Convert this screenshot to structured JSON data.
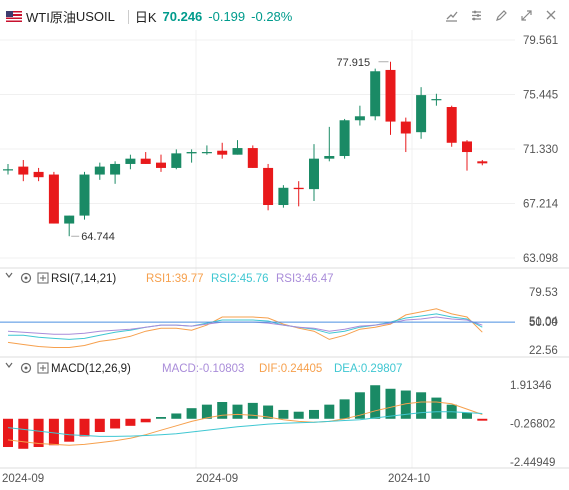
{
  "header": {
    "instrument": "WTI原油",
    "symbol": "USOIL",
    "period": "日K",
    "last": "70.246",
    "change": "-0.199",
    "change_pct": "-0.28%"
  },
  "colors": {
    "up": "#1a8a65",
    "down": "#e8191b",
    "rsi1": "#f6a04d",
    "rsi2": "#3fc7d2",
    "rsi3": "#a98cd9",
    "macd": "#a98cd9",
    "dif": "#f6a04d",
    "dea": "#3fc7d2",
    "accent": "#009b8c"
  },
  "chart_data": [
    {
      "type": "candlestick",
      "y_ticks": [
        "79.561",
        "75.445",
        "71.330",
        "67.214",
        "63.098"
      ],
      "ylim": [
        63.098,
        79.561
      ],
      "x_labels": [
        "2024-09",
        "2024-09",
        "2024-10"
      ],
      "annotations": {
        "high": "77.915",
        "low": "64.744"
      },
      "candles": [
        {
          "o": 69.8,
          "h": 70.2,
          "l": 69.4,
          "c": 69.8
        },
        {
          "o": 70.0,
          "h": 70.5,
          "l": 68.9,
          "c": 69.4
        },
        {
          "o": 69.6,
          "h": 69.9,
          "l": 68.9,
          "c": 69.2
        },
        {
          "o": 69.4,
          "h": 69.6,
          "l": 65.7,
          "c": 65.7
        },
        {
          "o": 65.7,
          "h": 66.3,
          "l": 64.744,
          "c": 66.3
        },
        {
          "o": 66.3,
          "h": 69.6,
          "l": 66.0,
          "c": 69.4
        },
        {
          "o": 69.4,
          "h": 70.3,
          "l": 69.0,
          "c": 70.0
        },
        {
          "o": 69.4,
          "h": 70.4,
          "l": 68.7,
          "c": 70.2
        },
        {
          "o": 70.2,
          "h": 70.9,
          "l": 69.8,
          "c": 70.6
        },
        {
          "o": 70.6,
          "h": 71.1,
          "l": 70.2,
          "c": 70.2
        },
        {
          "o": 70.3,
          "h": 70.9,
          "l": 69.6,
          "c": 69.9
        },
        {
          "o": 69.9,
          "h": 71.3,
          "l": 69.8,
          "c": 71.0
        },
        {
          "o": 71.0,
          "h": 71.3,
          "l": 70.3,
          "c": 71.1
        },
        {
          "o": 71.1,
          "h": 71.6,
          "l": 70.9,
          "c": 71.1
        },
        {
          "o": 71.2,
          "h": 71.8,
          "l": 70.6,
          "c": 70.9
        },
        {
          "o": 70.9,
          "h": 72.0,
          "l": 70.9,
          "c": 71.4
        },
        {
          "o": 71.4,
          "h": 71.6,
          "l": 69.9,
          "c": 69.9
        },
        {
          "o": 69.9,
          "h": 70.2,
          "l": 66.7,
          "c": 67.1
        },
        {
          "o": 67.1,
          "h": 68.6,
          "l": 66.9,
          "c": 68.4
        },
        {
          "o": 68.4,
          "h": 68.9,
          "l": 67.0,
          "c": 68.3
        },
        {
          "o": 68.3,
          "h": 71.7,
          "l": 67.4,
          "c": 70.6
        },
        {
          "o": 70.6,
          "h": 73.0,
          "l": 70.4,
          "c": 70.8
        },
        {
          "o": 70.8,
          "h": 73.6,
          "l": 70.6,
          "c": 73.5
        },
        {
          "o": 73.5,
          "h": 74.6,
          "l": 73.1,
          "c": 73.8
        },
        {
          "o": 73.8,
          "h": 77.4,
          "l": 73.5,
          "c": 77.2
        },
        {
          "o": 77.3,
          "h": 77.915,
          "l": 72.4,
          "c": 73.4
        },
        {
          "o": 73.4,
          "h": 73.7,
          "l": 71.1,
          "c": 72.5
        },
        {
          "o": 72.6,
          "h": 76.0,
          "l": 72.1,
          "c": 75.4
        },
        {
          "o": 75.1,
          "h": 75.5,
          "l": 74.6,
          "c": 75.1
        },
        {
          "o": 74.5,
          "h": 74.6,
          "l": 71.5,
          "c": 71.8
        },
        {
          "o": 71.9,
          "h": 72.0,
          "l": 69.7,
          "c": 71.1
        },
        {
          "o": 70.4,
          "h": 70.5,
          "l": 70.1,
          "c": 70.246
        }
      ]
    },
    {
      "type": "line",
      "name": "RSI",
      "label": "RSI(7,14,21)",
      "y_ticks": [
        "79.53",
        "51.04",
        "50.00",
        "22.56"
      ],
      "ylim": [
        22.56,
        79.53
      ],
      "series": [
        {
          "name": "RSI1:39.77",
          "values": [
            30,
            28,
            26,
            25,
            25,
            27,
            31,
            33,
            36,
            41,
            44,
            44,
            42,
            47,
            55,
            55,
            55,
            54,
            48,
            44,
            41,
            33,
            37,
            43,
            45,
            48,
            57,
            60,
            63,
            58,
            55,
            40
          ]
        },
        {
          "name": "RSI2:45.76",
          "values": [
            37,
            37,
            35,
            34,
            33,
            34,
            37,
            40,
            42,
            45,
            47,
            47,
            46,
            49,
            52,
            52,
            52,
            51,
            47,
            45,
            43,
            39,
            41,
            45,
            47,
            50,
            54,
            56,
            58,
            55,
            53,
            45
          ]
        },
        {
          "name": "RSI3:46.47",
          "values": [
            41,
            40,
            39,
            38,
            38,
            39,
            41,
            42,
            43,
            45,
            47,
            47,
            46,
            48,
            50,
            50,
            50,
            49,
            47,
            45,
            44,
            41,
            43,
            46,
            47,
            49,
            52,
            53,
            55,
            53,
            52,
            47
          ]
        }
      ]
    },
    {
      "type": "bar+line",
      "name": "MACD",
      "label": "MACD(12,26,9)",
      "y_ticks": [
        "1.91346",
        "-0.26802",
        "-2.44949"
      ],
      "ylim": [
        -2.44949,
        1.91346
      ],
      "series": [
        {
          "name": "MACD:-0.10803",
          "values": [
            -1.6,
            -1.7,
            -1.6,
            -1.5,
            -1.3,
            -1.0,
            -0.75,
            -0.55,
            -0.4,
            -0.2,
            0.1,
            0.3,
            0.6,
            0.8,
            0.95,
            0.8,
            0.9,
            0.75,
            0.5,
            0.4,
            0.5,
            0.8,
            1.1,
            1.5,
            1.9,
            1.7,
            1.6,
            1.5,
            1.2,
            0.8,
            0.35,
            -0.108
          ]
        },
        {
          "name": "DIF:0.24405",
          "values": [
            -1.2,
            -1.3,
            -1.4,
            -1.45,
            -1.5,
            -1.45,
            -1.35,
            -1.25,
            -1.1,
            -0.9,
            -0.65,
            -0.4,
            -0.15,
            0.05,
            0.2,
            0.25,
            0.2,
            0.1,
            -0.05,
            -0.15,
            -0.2,
            -0.15,
            0.0,
            0.2,
            0.45,
            0.65,
            0.85,
            0.95,
            0.95,
            0.85,
            0.55,
            0.244
          ]
        },
        {
          "name": "DEA:0.29807",
          "values": [
            -0.5,
            -0.6,
            -0.7,
            -0.8,
            -0.9,
            -0.95,
            -1.0,
            -1.0,
            -0.98,
            -0.95,
            -0.9,
            -0.85,
            -0.75,
            -0.65,
            -0.55,
            -0.45,
            -0.38,
            -0.3,
            -0.25,
            -0.22,
            -0.2,
            -0.15,
            -0.1,
            -0.05,
            0.05,
            0.15,
            0.25,
            0.35,
            0.4,
            0.4,
            0.35,
            0.298
          ]
        }
      ]
    }
  ]
}
